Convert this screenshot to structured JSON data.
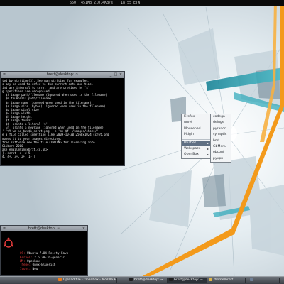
{
  "topbar": {
    "items": [
      "650",
      "451MB 210.4KB/s",
      "18:55 ETW"
    ]
  },
  "terminal": {
    "title": "brett@desktop: ~",
    "lines": [
      "ted by strftime(3). See man strftime for examples.",
      "s may be used to refer to the current date and time.",
      "ind are internal to scrot  and are prefixed by '$'",
      "g specifiers are recognised:",
      "  $f image path/filename (ignored when used in the filename)",
      "  $m thumbnail path/filename",
      "  $n image name (ignored when used in the filename)",
      "  $s image size (bytes) (ignored when used in the filename)",
      "  $p image pixel size",
      "  $w image width",
      "  $h image height",
      "  $t image format",
      "  $$  prints a literal '$'",
      "  \\n  prints a newline (ignored when used in the filename)",
      "",
      "' '%Y-%m-%d_$wx$h_scrot.png' -e 'mv $f ~/images/shots/'",
      "e a file called something like 2009-10-30_2560x1024_scrot.png",
      "moves it to your images directory.",
      "",
      "free software see the file COPYING for licensing info.",
      "Gilbert 2000",
      "ase email@linuxbrit.co.uk>",
      "]→ scrot -e -d 5",
      "4, 4+, 3+, 2+, 1+ |"
    ]
  },
  "term2": {
    "title": "brett@desktop: ~",
    "rows": [
      {
        "k": "OS:",
        "v": "Ubuntu 7.04 Feisty Fawn"
      },
      {
        "k": "Kernel:",
        "v": "2.6.20-16-generic"
      },
      {
        "k": "WM:",
        "v": "Openbox"
      },
      {
        "k": "Theme:",
        "v": "Onyx-Bluesish"
      },
      {
        "k": "Icons:",
        "v": "Neu"
      }
    ]
  },
  "root_menu": {
    "items": [
      {
        "label": "Firefox",
        "submenu": false,
        "highlighted": false
      },
      {
        "label": "urxvt",
        "submenu": false,
        "highlighted": false
      },
      {
        "label": "Mousepad",
        "submenu": false,
        "highlighted": false
      },
      {
        "label": "Pidgin",
        "submenu": false,
        "highlighted": false
      },
      {
        "label": "Utilities",
        "submenu": true,
        "highlighted": true
      },
      {
        "label": "Webspace",
        "submenu": true,
        "highlighted": false
      },
      {
        "label": "OpenBox",
        "submenu": true,
        "highlighted": false
      }
    ]
  },
  "sub_menu": {
    "items": [
      "codega",
      "deluge",
      "pyrandr",
      "synaptic",
      "bmt",
      "GbMenu",
      "obconf",
      "pyvpn"
    ]
  },
  "taskbar": {
    "tasks": [
      {
        "label": "Upload file - Openbox - Mozilla F",
        "active": false,
        "icon_color": "#e87b1e"
      },
      {
        "label": "brett@desktop: ~",
        "active": false,
        "icon_color": "#202020"
      },
      {
        "label": "brett@desktop: ~",
        "active": true,
        "icon_color": "#202020"
      },
      {
        "label": "/home/brett",
        "active": false,
        "icon_color": "#d9b24c"
      },
      {
        "label": "",
        "active": false,
        "icon_color": "#6f7f95"
      }
    ]
  },
  "colors": {
    "accent": "#5f6f83",
    "wallpaper_base": "#e8ecef",
    "wallpaper_highlight": "#f39a1b"
  }
}
